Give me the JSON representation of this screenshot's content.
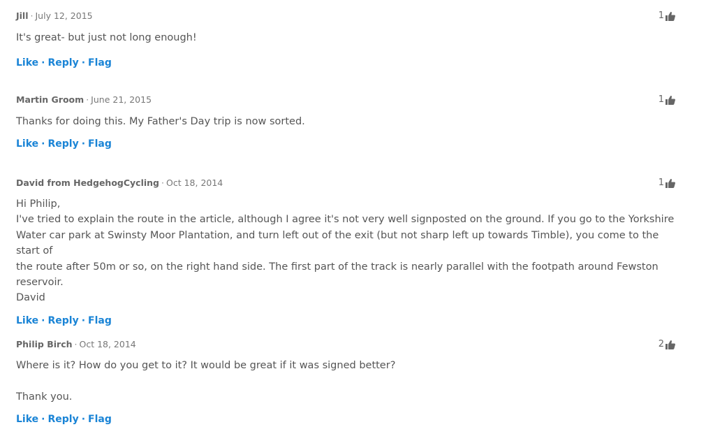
{
  "actions": {
    "like": "Like",
    "reply": "Reply",
    "flag": "Flag",
    "separator": "·"
  },
  "comments": [
    {
      "author": "Jill",
      "date": "July 12, 2015",
      "likes": "1",
      "lines": [
        "It's great- but just not long enough!"
      ]
    },
    {
      "author": "Martin Groom",
      "date": "June 21, 2015",
      "likes": "1",
      "lines": [
        "Thanks for doing this. My Father's Day trip is now sorted."
      ]
    },
    {
      "author": "David from HedgehogCycling",
      "date": "Oct 18, 2014",
      "likes": "1",
      "lines": [
        "Hi Philip,",
        "I've tried to explain the route in the article, although I agree it's not very well signposted on the ground. If you go to the Yorkshire",
        "Water car park at Swinsty Moor Plantation, and turn left out of the exit (but not sharp left up towards Timble), you come to the start of",
        "the route after 50m or so, on the right hand side. The first part of the track is nearly parallel with the footpath around Fewston",
        "reservoir.",
        "David"
      ]
    },
    {
      "author": "Philip Birch",
      "date": "Oct 18, 2014",
      "likes": "2",
      "lines": [
        "Where is it? How do you get to it? It would be great if it was signed better?",
        "",
        "Thank you."
      ]
    }
  ],
  "icons": {
    "like_count_icon": "thumbs-up-icon"
  },
  "colors": {
    "action_link": "#1a84d6",
    "author": "#666666",
    "text": "#555555",
    "meta": "#777777"
  }
}
